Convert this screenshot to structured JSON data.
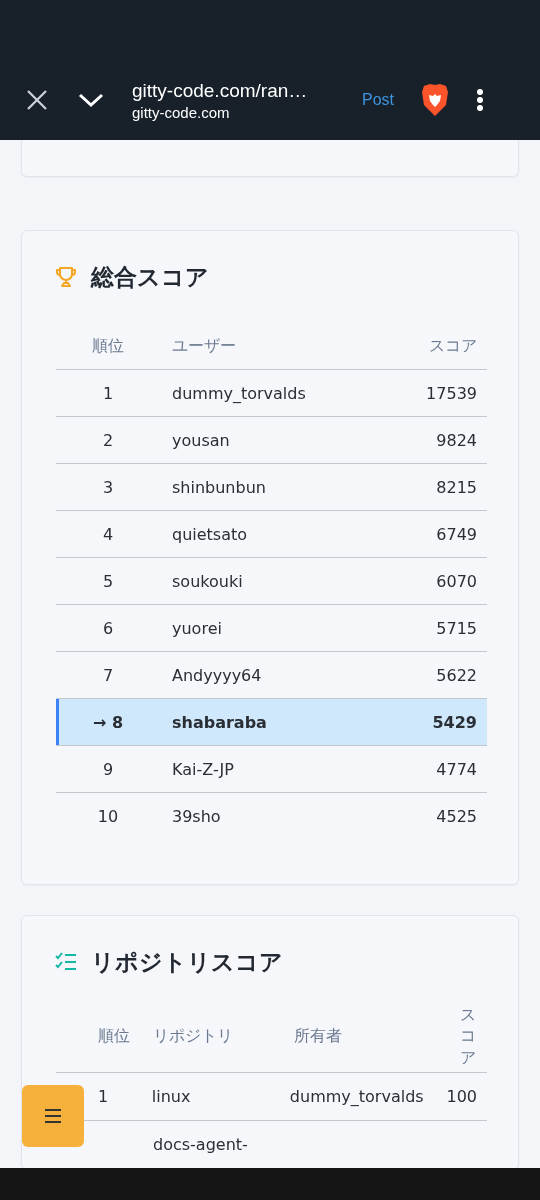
{
  "browser_bar": {
    "title": "gitty-code.com/ran…",
    "domain": "gitty-code.com",
    "post_label": "Post"
  },
  "overall_score": {
    "title": "総合スコア",
    "columns": [
      "順位",
      "ユーザー",
      "スコア"
    ],
    "rows": [
      {
        "rank": "1",
        "user": "dummy_torvalds",
        "score": "17539",
        "selected": false
      },
      {
        "rank": "2",
        "user": "yousan",
        "score": "9824",
        "selected": false
      },
      {
        "rank": "3",
        "user": "shinbunbun",
        "score": "8215",
        "selected": false
      },
      {
        "rank": "4",
        "user": "quietsato",
        "score": "6749",
        "selected": false
      },
      {
        "rank": "5",
        "user": "soukouki",
        "score": "6070",
        "selected": false
      },
      {
        "rank": "6",
        "user": "yuorei",
        "score": "5715",
        "selected": false
      },
      {
        "rank": "7",
        "user": "Andyyyy64",
        "score": "5622",
        "selected": false
      },
      {
        "rank": "8",
        "user": "shabaraba",
        "score": "5429",
        "selected": true,
        "marker": "→"
      },
      {
        "rank": "9",
        "user": "Kai-Z-JP",
        "score": "4774",
        "selected": false
      },
      {
        "rank": "10",
        "user": "39sho",
        "score": "4525",
        "selected": false
      }
    ]
  },
  "repository_score": {
    "title": "リポジトリスコア",
    "columns": [
      "順位",
      "リポジトリ",
      "所有者",
      "スコア"
    ],
    "rows": [
      {
        "rank": "1",
        "repository": "linux",
        "owner": "dummy_torvalds",
        "score": "100"
      },
      {
        "repository": "docs-agent-"
      }
    ]
  }
}
